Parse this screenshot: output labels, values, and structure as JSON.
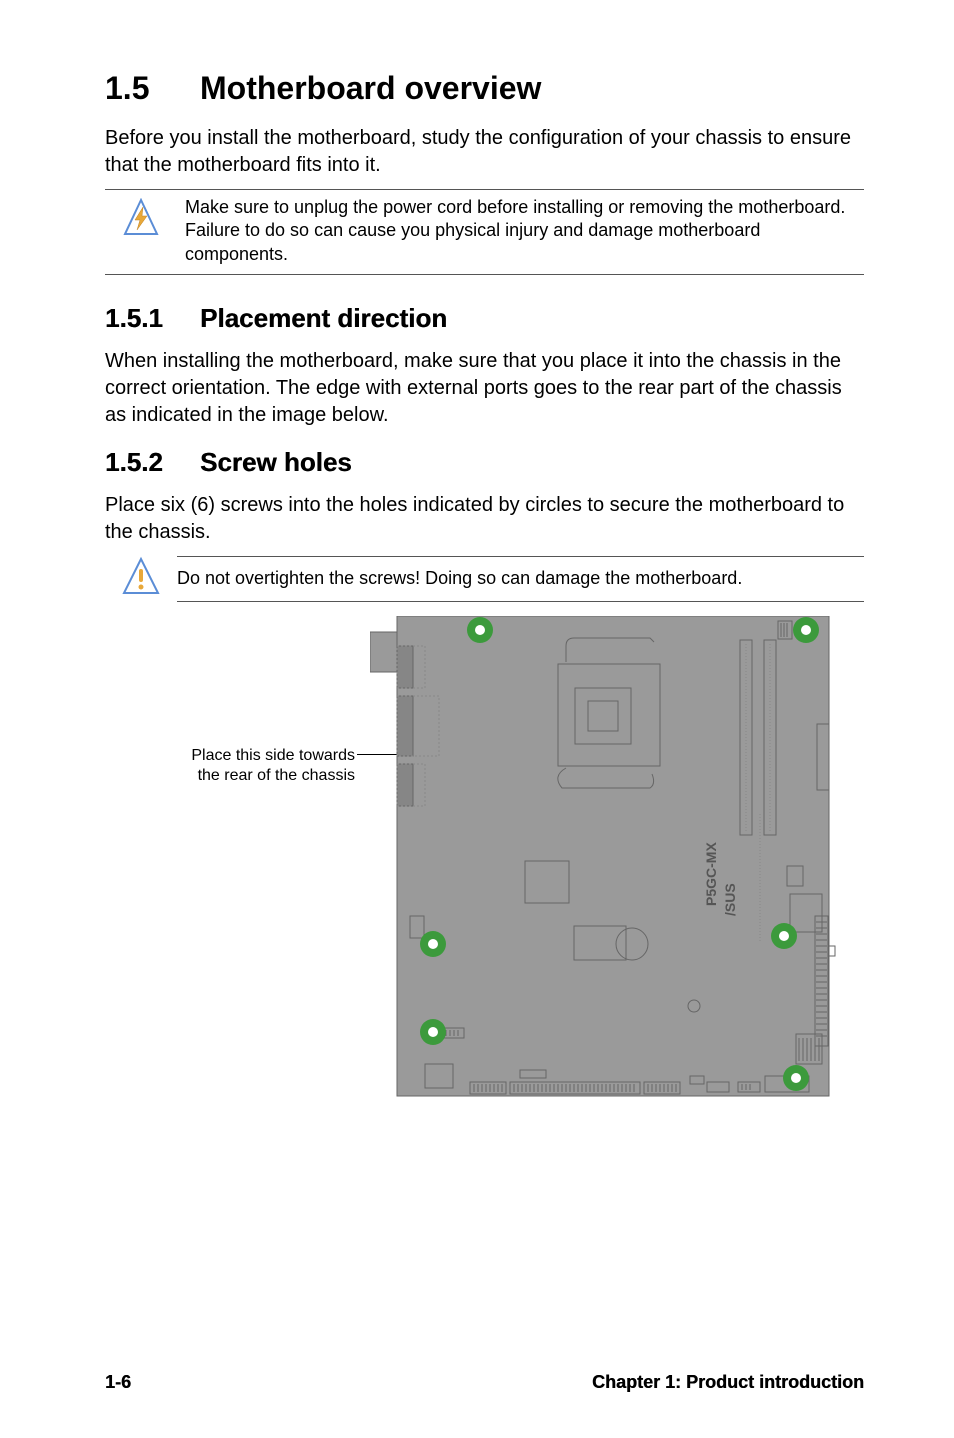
{
  "section": {
    "number": "1.5",
    "title": "Motherboard overview",
    "intro": "Before you install the motherboard, study the configuration of your chassis to ensure that the motherboard fits into it."
  },
  "warning1": "Make sure to unplug the power cord before installing or removing the motherboard. Failure to do so can cause you physical injury and damage motherboard components.",
  "sub1": {
    "number": "1.5.1",
    "title": "Placement direction",
    "body": "When installing the motherboard, make sure that you place it into the chassis in the correct orientation. The edge with external ports goes to the rear part of the chassis as indicated in the image below."
  },
  "sub2": {
    "number": "1.5.2",
    "title": "Screw holes",
    "body": "Place six (6) screws into the holes indicated by circles to secure the motherboard to the chassis."
  },
  "warning2": "Do not overtighten the screws! Doing so can damage the motherboard.",
  "diagram": {
    "caption_line1": "Place this side towards",
    "caption_line2": "the rear of the chassis",
    "board_model": "P5GC-MX"
  },
  "footer": {
    "page": "1-6",
    "chapter": "Chapter 1: Product introduction"
  }
}
